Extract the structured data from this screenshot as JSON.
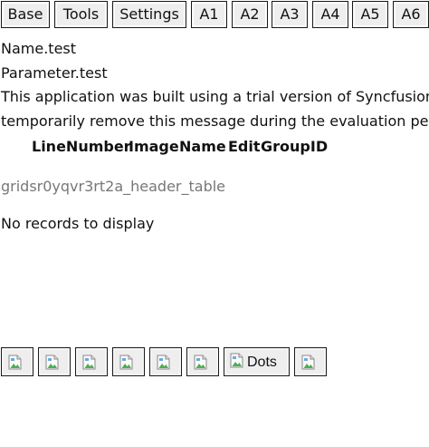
{
  "toolbar": {
    "buttons": [
      {
        "label": "Base"
      },
      {
        "label": "Tools"
      },
      {
        "label": "Settings"
      },
      {
        "label": "A1"
      },
      {
        "label": "A2"
      },
      {
        "label": "A3"
      },
      {
        "label": "A4"
      },
      {
        "label": "A5"
      },
      {
        "label": "A6"
      }
    ]
  },
  "info": {
    "name": "Name.test",
    "parameter": "Parameter.test",
    "trial_line1": "This application was built using a trial version of Syncfusion",
    "trial_line2": "temporarily remove this message during the evaluation per"
  },
  "grid": {
    "columns": [
      "LineNumber",
      "Image",
      "Name",
      "Edit",
      "GroupID"
    ],
    "header_table_id": "gridsr0yqvr3rt2a_header_table",
    "empty_message": "No records to display"
  },
  "bottom_toolbar": {
    "dots_alt": "Dots"
  }
}
